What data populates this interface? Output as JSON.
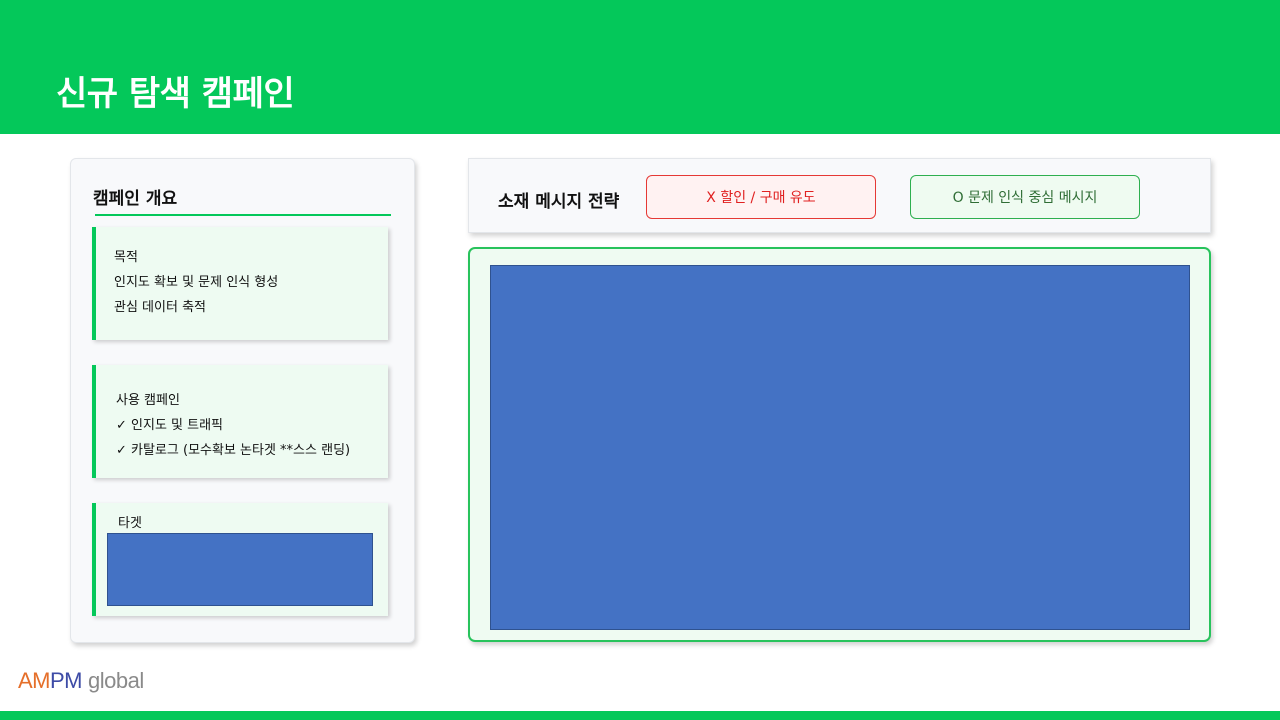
{
  "header": {
    "title": "신규 탐색 캠페인"
  },
  "overview": {
    "title": "캠페인 개요",
    "purpose": {
      "heading": "목적",
      "lines": [
        "인지도 확보 및 문제 인식 형성",
        "관심 데이터 축적"
      ]
    },
    "campaigns": {
      "heading": "사용 캠페인",
      "items": [
        "✓  인지도 및 트래픽",
        "✓  카탈로그 (모수확보 논타겟 **스스 랜딩)"
      ]
    },
    "target": {
      "heading": "타겟"
    }
  },
  "strategy": {
    "label": "소재 메시지 전략",
    "bad": "X 할인 / 구매 유도",
    "good": "O 문제 인식 중심 메시지"
  },
  "logo": {
    "am": "AM",
    "pm": "PM",
    "global": "global"
  },
  "colors": {
    "brand_green": "#04c85a",
    "placeholder_blue": "#4472c4",
    "bad_red": "#e02020",
    "good_green": "#2f6d35"
  }
}
